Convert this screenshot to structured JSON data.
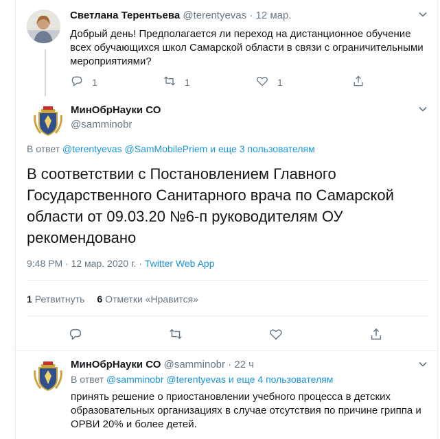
{
  "colors": {
    "link": "#1b95e0",
    "secondary": "#657786",
    "border": "#e6ecf0",
    "text": "#14171a"
  },
  "tweet1": {
    "author_name": "Светлана Терентьева",
    "author_handle": "@terentyevas",
    "separator": "·",
    "time": "12 мар.",
    "text": "Добрый день! Предполагается ли переход на дистанционное обучение всех обучающихся школ Самарской области в связи с ограничительными мероприятиями?",
    "reply_count": "1",
    "retweet_count": "1",
    "like_count": "1",
    "icons": [
      "reply-icon",
      "retweet-icon",
      "like-icon",
      "share-icon",
      "chevron-down-icon"
    ]
  },
  "main_tweet": {
    "author_name": "МинОбрНауки СО",
    "author_handle": "@samminobr",
    "reply_prefix": "В ответ",
    "reply_handle_1": "@terentyevas",
    "reply_handle_2": "@SamMobilePriem",
    "reply_and": "и",
    "reply_others": "еще 3 пользователям",
    "text": "В соответствии с Постановлением Главного Государственного Санитарного врача по Самарской области от 09.03.20 №6-п руководителям  ОУ рекомендовано",
    "time": "9:48 PM",
    "separator": "·",
    "date": "12 мар. 2020 г.",
    "source": "Twitter Web App",
    "retweets_count": "1",
    "retweets_label": "Ретвитнуть",
    "likes_count": "6",
    "likes_label": "Отметки «Нравится»",
    "icons": [
      "reply-icon",
      "retweet-icon",
      "like-icon",
      "share-icon",
      "chevron-down-icon"
    ]
  },
  "tweet3": {
    "author_name": "МинОбрНауки СО",
    "author_handle": "@samminobr",
    "separator": "·",
    "time": "22 ч",
    "reply_prefix": "В ответ",
    "reply_handle_1": "@samminobr",
    "reply_handle_2": "@terentyevas",
    "reply_and": "и",
    "reply_others": "еще 4 пользователям",
    "text": "принять решение о приостановлении учебного процесса в детских образовательных организациях в случае отсутствия по причине гриппа и ОРВИ 20% и более детей."
  }
}
